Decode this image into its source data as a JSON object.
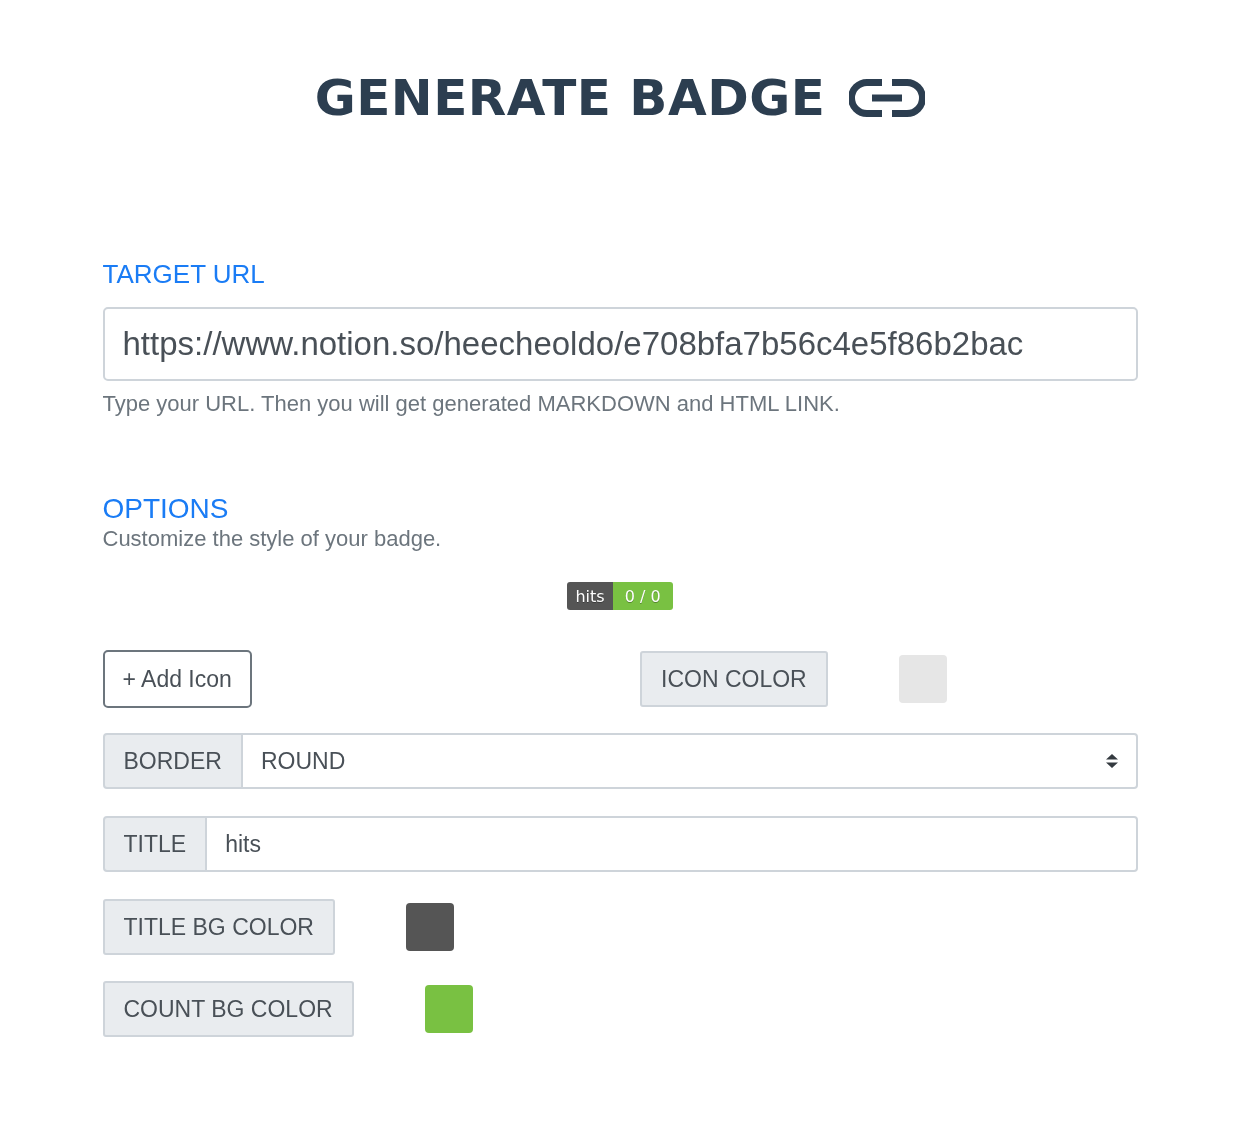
{
  "header": {
    "title": "GENERATE BADGE"
  },
  "target_url": {
    "label": "TARGET URL",
    "value": "https://www.notion.so/heecheoldo/e708bfa7b56c4e5f86b2bac",
    "help": "Type your URL. Then you will get generated MARKDOWN and HTML LINK."
  },
  "options": {
    "heading": "OPTIONS",
    "description": "Customize the style of your badge."
  },
  "badge_preview": {
    "title": "hits",
    "count": "0 / 0"
  },
  "add_icon_button": {
    "label": "+ Add Icon"
  },
  "icon_color": {
    "label": "ICON COLOR",
    "color": "#e6e6e6"
  },
  "border": {
    "label": "BORDER",
    "value": "ROUND"
  },
  "title_field": {
    "label": "TITLE",
    "value": "hits"
  },
  "color_options": [
    {
      "label": "TITLE BG COLOR",
      "color": "#555555"
    },
    {
      "label": "COUNT BG COLOR",
      "color": "#79c142"
    }
  ]
}
